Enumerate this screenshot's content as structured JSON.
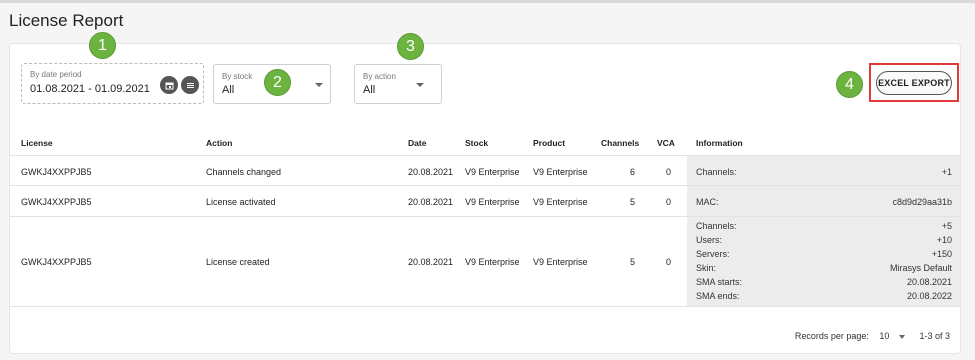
{
  "page": {
    "title": "License Report"
  },
  "filters": {
    "date": {
      "label": "By date period",
      "value": "01.08.2021 - 01.09.2021",
      "calendar_icon": "calendar-icon",
      "list_icon": "list-icon"
    },
    "stock": {
      "label": "By stock",
      "value": "All"
    },
    "action": {
      "label": "By action",
      "value": "All"
    }
  },
  "callouts": [
    "1",
    "2",
    "3",
    "4"
  ],
  "toolbar": {
    "export_label": "EXCEL EXPORT"
  },
  "table": {
    "columns": [
      "License",
      "Action",
      "Date",
      "Stock",
      "Product",
      "Channels",
      "VCA",
      "Information"
    ],
    "rows": [
      {
        "license": "GWKJ4XXPPJB5",
        "action": "Channels changed",
        "date": "20.08.2021",
        "stock": "V9 Enterprise",
        "product": "V9 Enterprise",
        "channels": "6",
        "vca": "0",
        "info": [
          {
            "k": "Channels:",
            "v": "+1"
          }
        ]
      },
      {
        "license": "GWKJ4XXPPJB5",
        "action": "License activated",
        "date": "20.08.2021",
        "stock": "V9 Enterprise",
        "product": "V9 Enterprise",
        "channels": "5",
        "vca": "0",
        "info": [
          {
            "k": "MAC:",
            "v": "c8d9d29aa31b"
          }
        ]
      },
      {
        "license": "GWKJ4XXPPJB5",
        "action": "License created",
        "date": "20.08.2021",
        "stock": "V9 Enterprise",
        "product": "V9 Enterprise",
        "channels": "5",
        "vca": "0",
        "info": [
          {
            "k": "Channels:",
            "v": "+5"
          },
          {
            "k": "Users:",
            "v": "+10"
          },
          {
            "k": "Servers:",
            "v": "+150"
          },
          {
            "k": "Skin:",
            "v": "Mirasys Default"
          },
          {
            "k": "SMA starts:",
            "v": "20.08.2021"
          },
          {
            "k": "SMA ends:",
            "v": "20.08.2022"
          }
        ]
      }
    ]
  },
  "pagination": {
    "label": "Records per page:",
    "per_page": "10",
    "range": "1-3 of 3"
  }
}
